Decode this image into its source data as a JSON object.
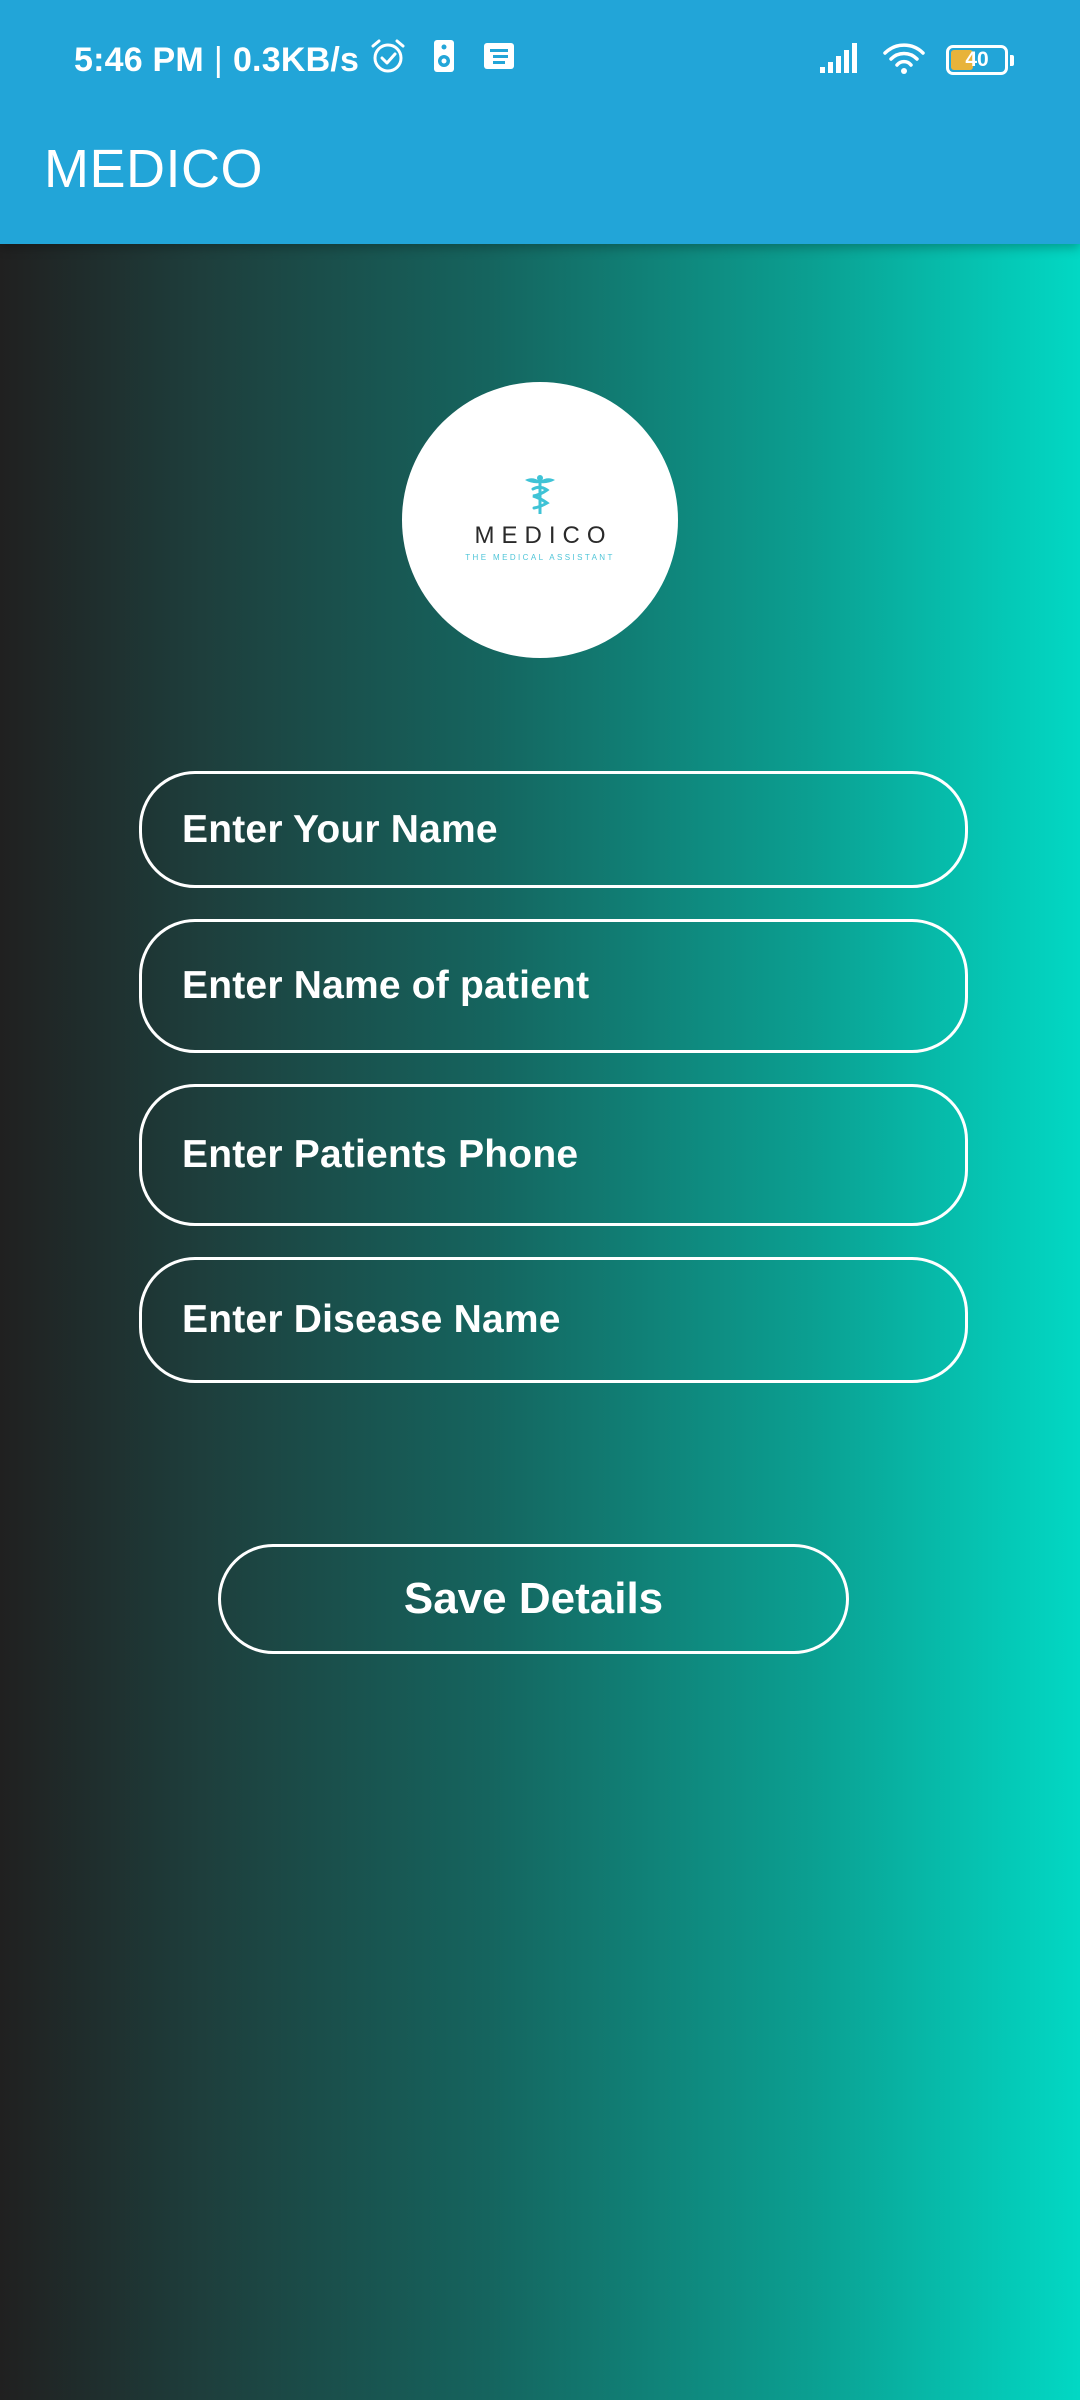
{
  "status_bar": {
    "time": "5:46 PM",
    "separator": "|",
    "network_speed": "0.3KB/s",
    "icons_left": [
      "alarm-icon",
      "speaker-icon",
      "notification-icon"
    ],
    "icons_right": [
      "signal-icon",
      "wifi-icon",
      "battery-icon"
    ],
    "battery_level": "40"
  },
  "app_bar": {
    "title": "MEDICO",
    "color": "#22a5d8"
  },
  "logo": {
    "icon": "caduceus-icon",
    "wordmark": "MEDICO",
    "tagline": "THE MEDICAL ASSISTANT",
    "accent_color": "#3fc3d6"
  },
  "form": {
    "your_name_placeholder": "Enter Your Name",
    "patient_name_placeholder": "Enter Name of patient",
    "patient_phone_placeholder": "Enter Patients Phone",
    "disease_name_placeholder": "Enter Disease Name",
    "save_button_label": "Save Details"
  },
  "theme": {
    "gradient_start": "#202020",
    "gradient_end": "#02d8c4",
    "field_border": "#ffffff"
  }
}
